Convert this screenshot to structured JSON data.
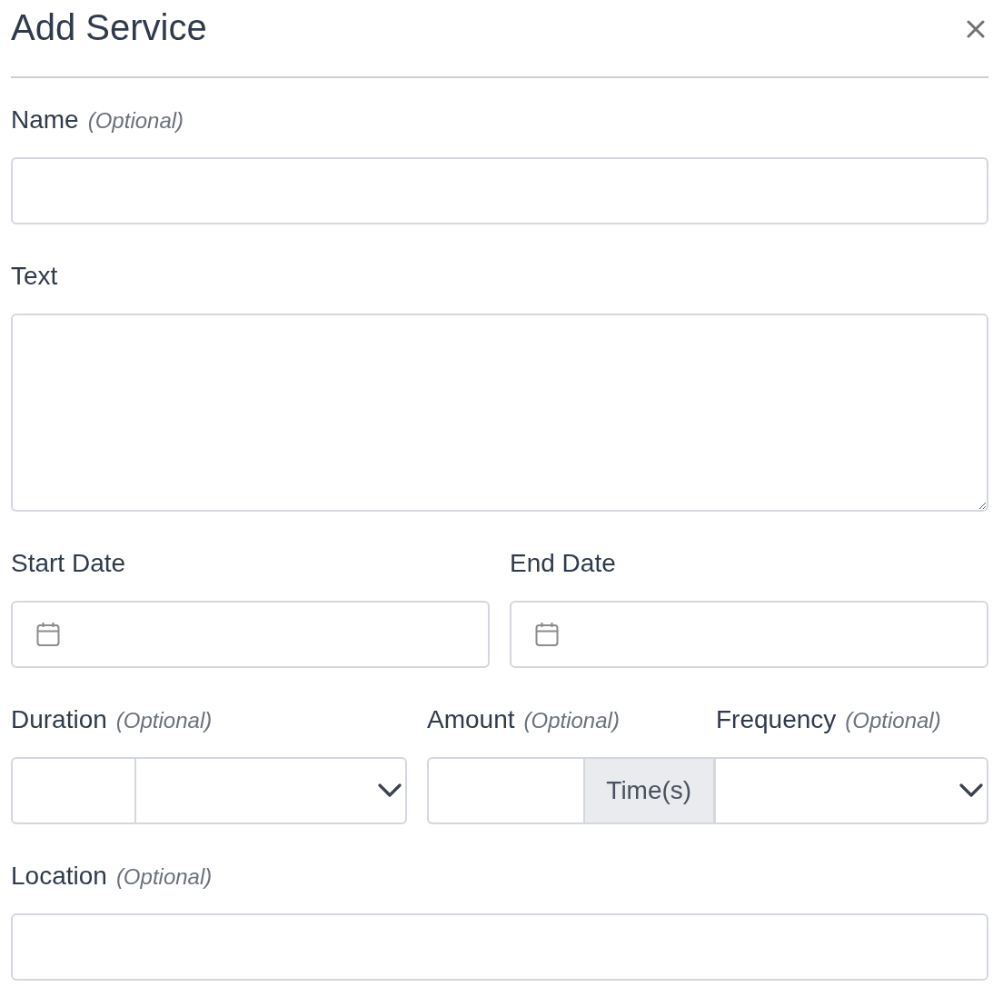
{
  "dialog": {
    "title": "Add Service"
  },
  "rows": [
    {
      "fields": [
        {
          "kind": "text",
          "label": "Name",
          "note": "(Optional)"
        }
      ]
    },
    {
      "fields": [
        {
          "kind": "textarea",
          "label": "Text"
        }
      ]
    },
    {
      "fields": [
        {
          "kind": "date",
          "label": "Start Date"
        },
        {
          "kind": "date",
          "label": "End Date"
        }
      ]
    },
    {
      "fields": [
        {
          "kind": "number_unit",
          "label": "Duration",
          "note": "(Optional)"
        },
        {
          "kind": "number_addon",
          "label": "Amount",
          "note": "(Optional)",
          "addon": "Time(s)"
        },
        {
          "kind": "select",
          "label": "Frequency",
          "note": "(Optional)"
        }
      ]
    },
    {
      "fields": [
        {
          "kind": "text",
          "label": "Location",
          "note": "(Optional)"
        }
      ]
    }
  ]
}
